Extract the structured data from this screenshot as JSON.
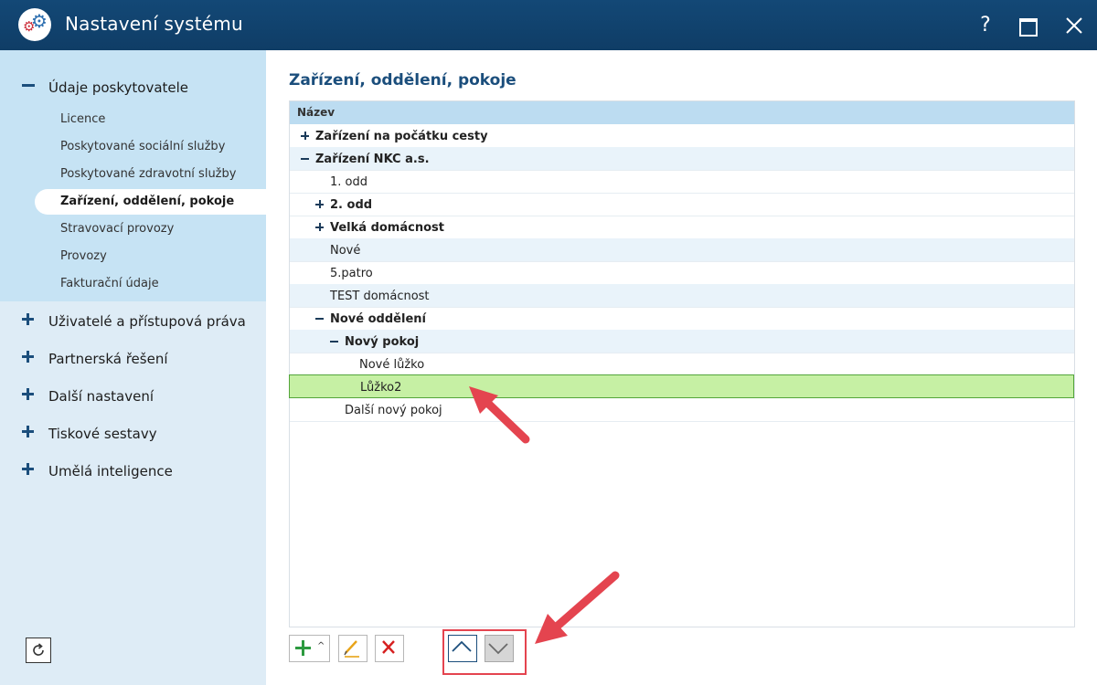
{
  "window": {
    "title": "Nastavení systému",
    "help_label": "?",
    "close_label": "✕"
  },
  "sidebar": {
    "groups": [
      {
        "label": "Údaje poskytovatele",
        "expanded": true,
        "items": [
          {
            "label": "Licence"
          },
          {
            "label": "Poskytované sociální služby"
          },
          {
            "label": "Poskytované zdravotní služby"
          },
          {
            "label": "Zařízení, oddělení, pokoje",
            "active": true
          },
          {
            "label": "Stravovací provozy"
          },
          {
            "label": "Provozy"
          },
          {
            "label": "Fakturační údaje"
          }
        ]
      },
      {
        "label": "Uživatelé a přístupová práva",
        "expanded": false
      },
      {
        "label": "Partnerská řešení",
        "expanded": false
      },
      {
        "label": "Další nastavení",
        "expanded": false
      },
      {
        "label": "Tiskové sestavy",
        "expanded": false
      },
      {
        "label": "Umělá inteligence",
        "expanded": false
      }
    ],
    "refresh_icon": "refresh-icon"
  },
  "main": {
    "title": "Zařízení, oddělení, pokoje",
    "tree": {
      "column_header": "Název",
      "rows": [
        {
          "label": "Zařízení na počátku cesty",
          "bold": true,
          "expander": "plus"
        },
        {
          "label": "Zařízení NKC a.s.",
          "bold": true,
          "expander": "minus"
        },
        {
          "label": "1. odd",
          "bold": false,
          "expander": ""
        },
        {
          "label": "2. odd",
          "bold": true,
          "expander": "plus"
        },
        {
          "label": "Velká domácnost",
          "bold": true,
          "expander": "plus"
        },
        {
          "label": "Nové",
          "bold": false,
          "expander": ""
        },
        {
          "label": "5.patro",
          "bold": false,
          "expander": ""
        },
        {
          "label": "TEST domácnost",
          "bold": false,
          "expander": ""
        },
        {
          "label": "Nové oddělení",
          "bold": true,
          "expander": "minus"
        },
        {
          "label": "Nový pokoj",
          "bold": true,
          "expander": "minus"
        },
        {
          "label": "Nové lůžko",
          "bold": false,
          "expander": ""
        },
        {
          "label": "Lůžko2",
          "bold": false,
          "expander": "",
          "selected": true
        },
        {
          "label": "Další nový pokoj",
          "bold": false,
          "expander": ""
        }
      ]
    },
    "toolbar": {
      "add_icon": "add-icon",
      "edit_icon": "pencil-icon",
      "delete_icon": "delete-icon",
      "move_up_icon": "chevron-up-icon",
      "move_down_icon": "chevron-down-icon"
    }
  },
  "colors": {
    "titlebar": "#134876",
    "accent": "#1b4e7c",
    "sidebar_bg": "#deecf6",
    "selected_row": "#c6f0a4",
    "annotation": "#e4444f"
  }
}
